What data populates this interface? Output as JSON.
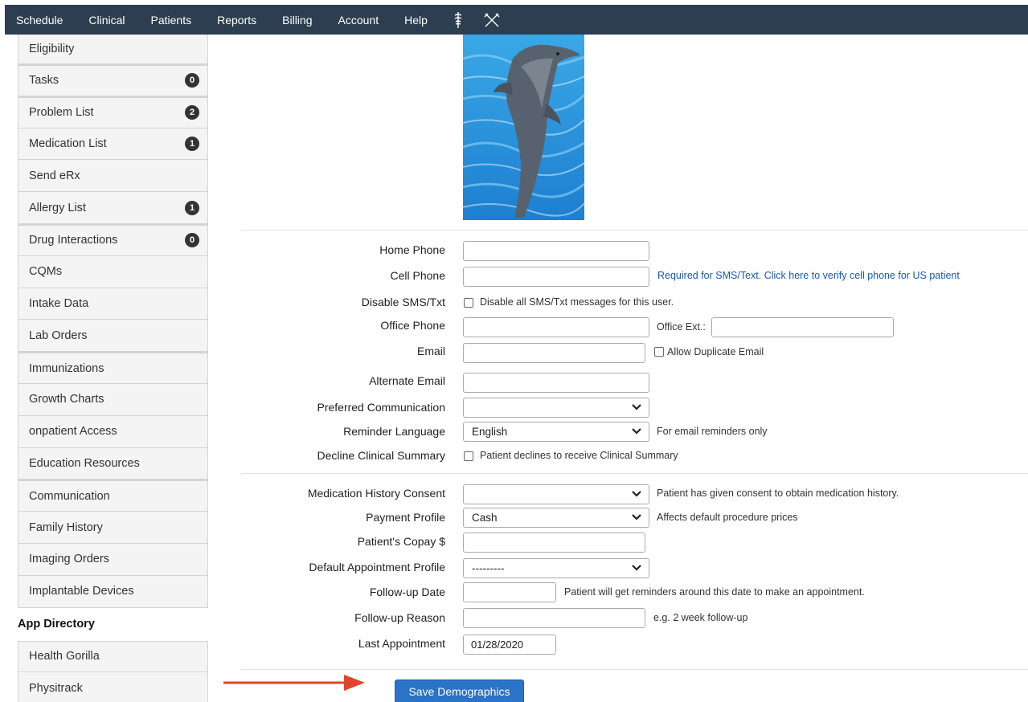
{
  "nav": {
    "items": [
      "Schedule",
      "Clinical",
      "Patients",
      "Reports",
      "Billing",
      "Account",
      "Help"
    ],
    "icons": [
      "caduceus-icon",
      "swords-icon"
    ]
  },
  "sidebar": {
    "items": [
      {
        "label": "Eligibility",
        "badge": null
      },
      {
        "label": "Tasks",
        "badge": "0"
      },
      {
        "label": "Problem List",
        "badge": "2"
      },
      {
        "label": "Medication List",
        "badge": "1"
      },
      {
        "label": "Send eRx",
        "badge": null
      },
      {
        "label": "Allergy List",
        "badge": "1"
      },
      {
        "label": "Drug Interactions",
        "badge": "0"
      },
      {
        "label": "CQMs",
        "badge": null
      },
      {
        "label": "Intake Data",
        "badge": null
      },
      {
        "label": "Lab Orders",
        "badge": null
      },
      {
        "label": "Immunizations",
        "badge": null
      },
      {
        "label": "Growth Charts",
        "badge": null
      },
      {
        "label": "onpatient Access",
        "badge": null
      },
      {
        "label": "Education Resources",
        "badge": null
      },
      {
        "label": "Communication",
        "badge": null
      },
      {
        "label": "Family History",
        "badge": null
      },
      {
        "label": "Imaging Orders",
        "badge": null
      },
      {
        "label": "Implantable Devices",
        "badge": null
      }
    ],
    "app_heading": "App Directory",
    "apps": [
      {
        "label": "Health Gorilla"
      },
      {
        "label": "Physitrack"
      }
    ]
  },
  "form": {
    "home_phone": {
      "label": "Home Phone",
      "value": ""
    },
    "cell_phone": {
      "label": "Cell Phone",
      "value": "",
      "hint": "Required for SMS/Text. Click here to verify cell phone for US patient"
    },
    "disable_sms": {
      "label": "Disable SMS/Txt",
      "checkbox_label": "Disable all SMS/Txt messages for this user.",
      "checked": false
    },
    "office_phone": {
      "label": "Office Phone",
      "value": "",
      "ext_label": "Office Ext.:",
      "ext_value": ""
    },
    "email": {
      "label": "Email",
      "value": "",
      "dup_label": "Allow Duplicate Email",
      "dup_checked": false
    },
    "alt_email": {
      "label": "Alternate Email",
      "value": ""
    },
    "preferred_comm": {
      "label": "Preferred Communication",
      "value": ""
    },
    "reminder_lang": {
      "label": "Reminder Language",
      "value": "English",
      "hint": "For email reminders only"
    },
    "decline_summary": {
      "label": "Decline Clinical Summary",
      "checkbox_label": "Patient declines to receive Clinical Summary",
      "checked": false
    },
    "med_consent": {
      "label": "Medication History Consent",
      "value": "",
      "hint": "Patient has given consent to obtain medication history."
    },
    "payment_profile": {
      "label": "Payment Profile",
      "value": "Cash",
      "hint": "Affects default procedure prices"
    },
    "copay": {
      "label": "Patient's Copay $",
      "value": ""
    },
    "appt_profile": {
      "label": "Default Appointment Profile",
      "value": "---------"
    },
    "followup_date": {
      "label": "Follow-up Date",
      "value": "",
      "hint": "Patient will get reminders around this date to make an appointment."
    },
    "followup_reason": {
      "label": "Follow-up Reason",
      "value": "",
      "hint": "e.g. 2 week follow-up"
    },
    "last_appt": {
      "label": "Last Appointment",
      "value": "01/28/2020"
    }
  },
  "save_label": "Save Demographics",
  "colors": {
    "nav_bg": "#2d3e50",
    "button": "#2b73c6",
    "link": "#1a58b0",
    "arrow": "#e0452c"
  }
}
